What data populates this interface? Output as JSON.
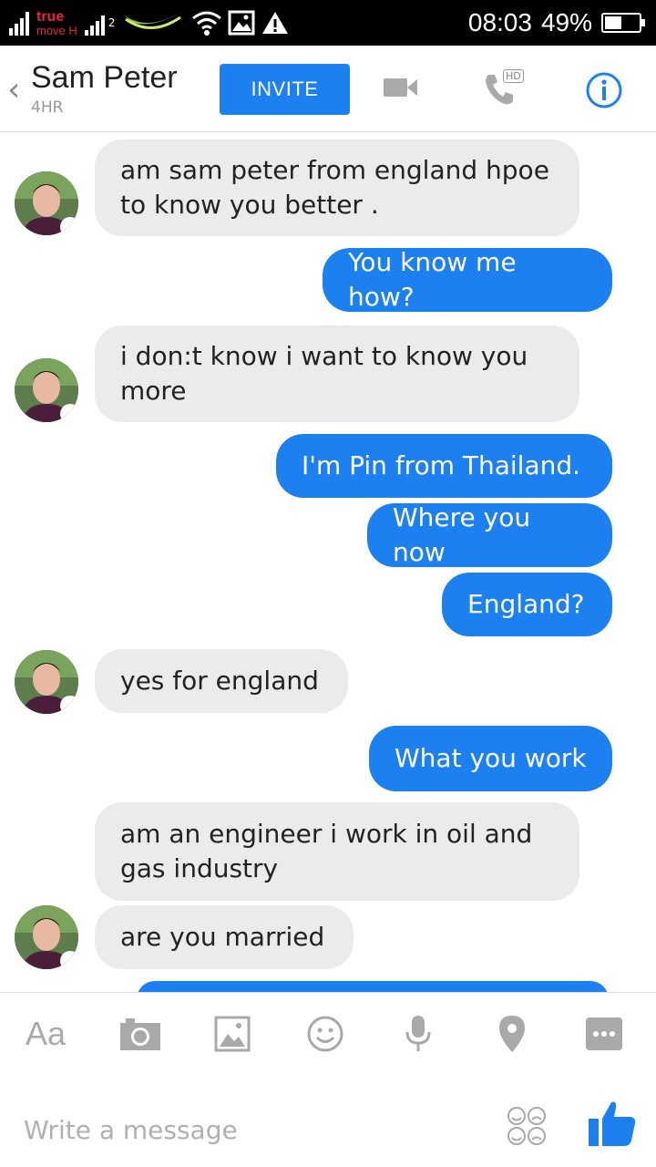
{
  "status_bar": {
    "carrier_line1": "true",
    "carrier_line2": "move H",
    "network2": "2",
    "time": "08:03",
    "battery": "49%",
    "battery_level": 0.49
  },
  "header": {
    "back_icon": "chevron-left-icon",
    "contact_name": "Sam Peter",
    "last_active": "4HR",
    "invite_label": "INVITE",
    "video_icon": "video-camera-icon",
    "call_badge": "HD",
    "info_icon": "info-icon",
    "accent": "#1d80f0"
  },
  "messages": [
    {
      "from": "them",
      "text_lines": [
        "am sam peter from england hpoe",
        "to know you better ."
      ]
    },
    {
      "from": "me",
      "text_lines": [
        "You know me how?"
      ]
    },
    {
      "from": "them",
      "text_lines": [
        "i don:t know i want to know you",
        "more"
      ]
    },
    {
      "from": "me",
      "text_lines": [
        "I'm Pin from Thailand."
      ]
    },
    {
      "from": "me",
      "text_lines": [
        "Where you now"
      ]
    },
    {
      "from": "me",
      "text_lines": [
        "England?"
      ]
    },
    {
      "from": "them",
      "text_lines": [
        "yes for england"
      ]
    },
    {
      "from": "me",
      "text_lines": [
        "What you work"
      ]
    },
    {
      "from": "them",
      "text_lines": [
        "am an engineer i work in oil and",
        "gas industry"
      ]
    },
    {
      "from": "them",
      "text_lines": [
        "are you married"
      ]
    }
  ],
  "toolbar": {
    "text_toggle": "Aa",
    "icons": [
      "camera-icon",
      "gallery-icon",
      "emoji-icon",
      "microphone-icon",
      "location-icon",
      "more-icon"
    ]
  },
  "composer": {
    "placeholder": "Write a message",
    "stickers_icon": "stickers-icon",
    "like_icon": "thumbs-up-icon"
  }
}
